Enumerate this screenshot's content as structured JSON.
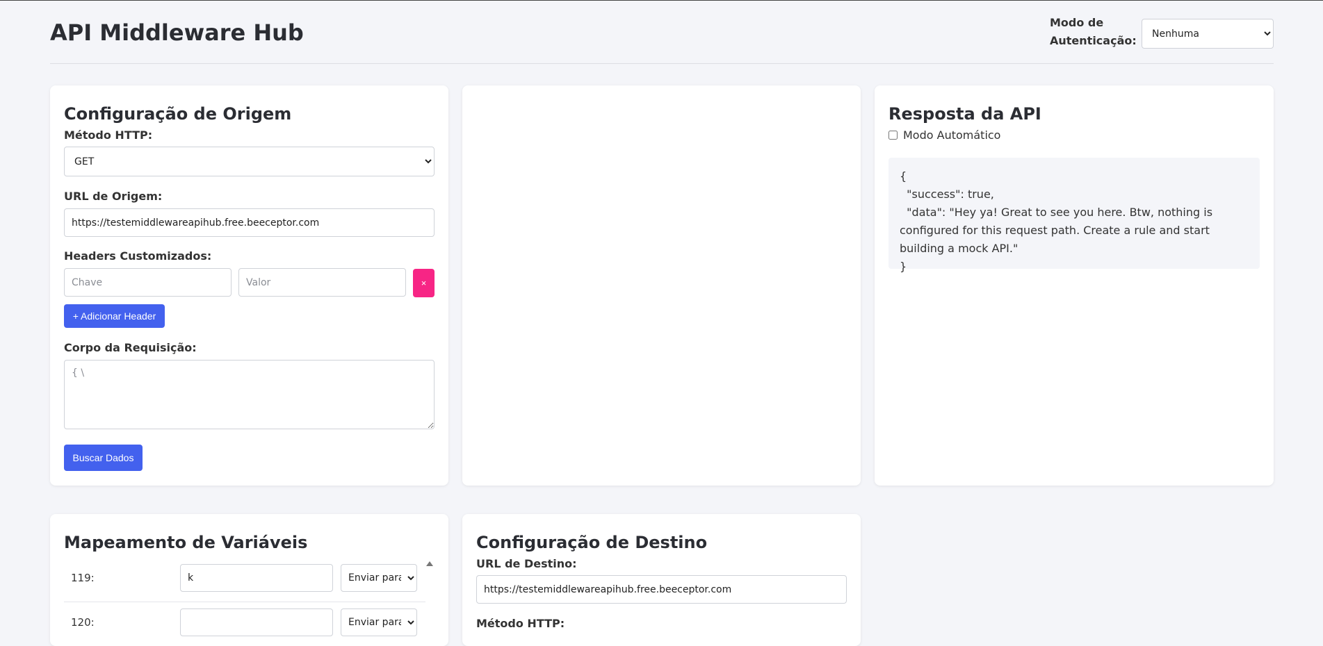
{
  "header": {
    "title": "API Middleware Hub",
    "auth_label": "Modo de Autenticação:",
    "auth_value": "Nenhuma"
  },
  "origin": {
    "title": "Configuração de Origem",
    "method_label": "Método HTTP:",
    "method_value": "GET",
    "url_label": "URL de Origem:",
    "url_value": "https://testemiddlewareapihub.free.beeceptor.com",
    "headers_label": "Headers Customizados:",
    "header_key_placeholder": "Chave",
    "header_value_placeholder": "Valor",
    "remove_label": "×",
    "add_header_label": "+ Adicionar Header",
    "body_label": "Corpo da Requisição:",
    "body_placeholder": "{ \\",
    "fetch_label": "Buscar Dados"
  },
  "response": {
    "title": "Resposta da API",
    "auto_mode_label": "Modo Automático",
    "auto_mode_checked": false,
    "body": "{\n  \"success\": true,\n  \"data\": \"Hey ya! Great to see you here. Btw, nothing is configured for this request path. Create a rule and start building a mock API.\"\n}"
  },
  "mapping": {
    "title": "Mapeamento de Variáveis",
    "rows": [
      {
        "index": "119:",
        "value": "k",
        "action": "Enviar para"
      },
      {
        "index": "120:",
        "value": "",
        "action": "Enviar para"
      }
    ]
  },
  "destination": {
    "title": "Configuração de Destino",
    "url_label": "URL de Destino:",
    "url_value": "https://testemiddlewareapihub.free.beeceptor.com",
    "method_label": "Método HTTP:"
  }
}
